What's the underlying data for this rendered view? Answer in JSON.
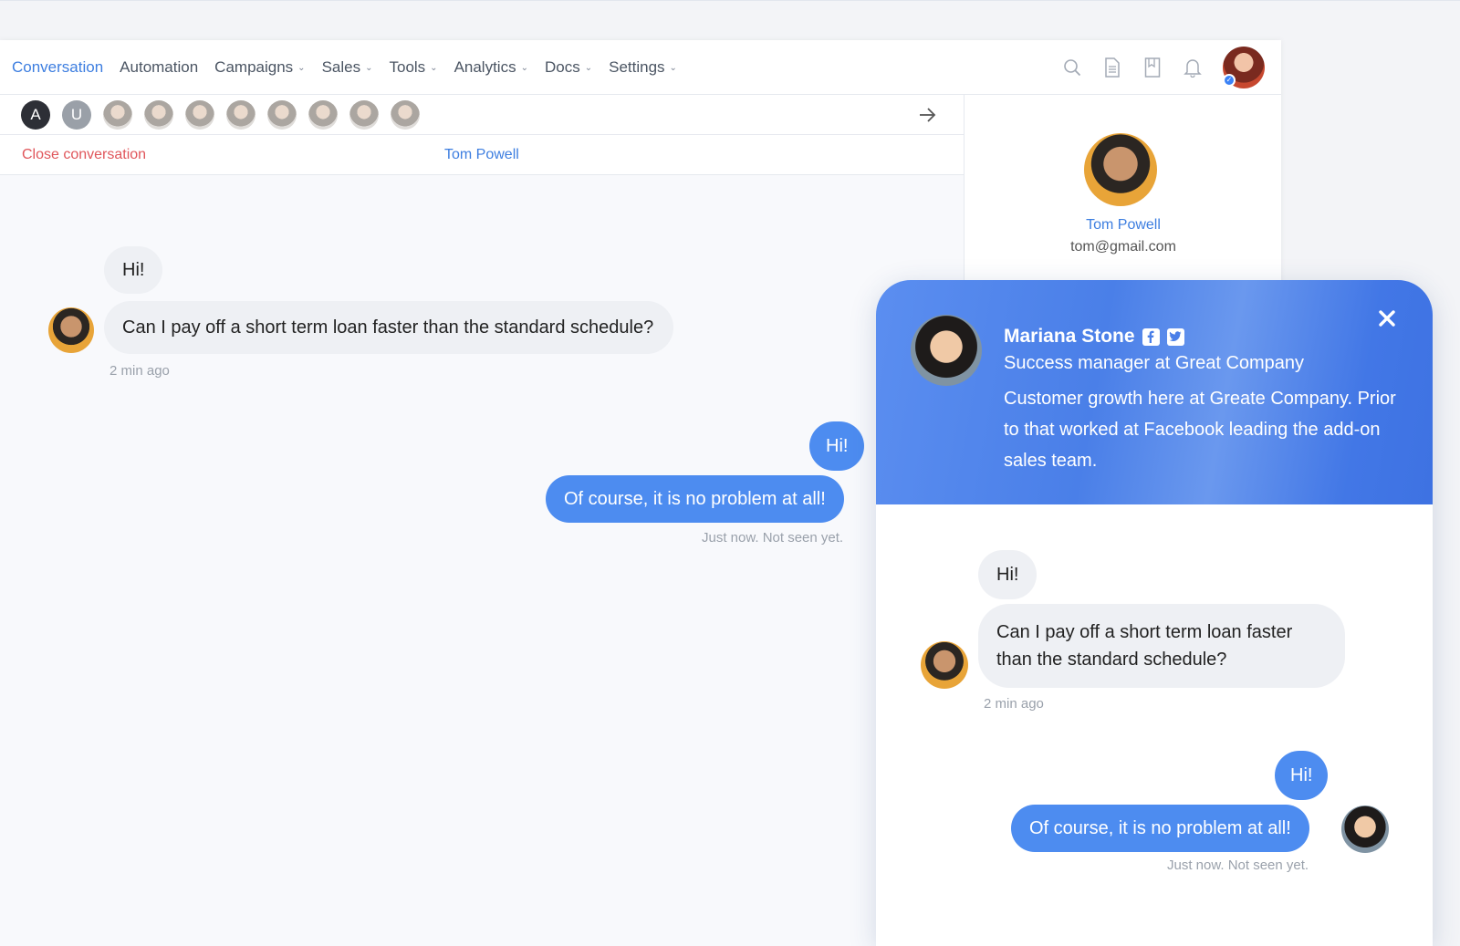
{
  "nav": {
    "items": [
      {
        "label": "Conversation",
        "active": true,
        "dropdown": false
      },
      {
        "label": "Automation",
        "active": false,
        "dropdown": false
      },
      {
        "label": "Campaigns",
        "active": false,
        "dropdown": true
      },
      {
        "label": "Sales",
        "active": false,
        "dropdown": true
      },
      {
        "label": "Tools",
        "active": false,
        "dropdown": true
      },
      {
        "label": "Analytics",
        "active": false,
        "dropdown": true
      },
      {
        "label": "Docs",
        "active": false,
        "dropdown": true
      },
      {
        "label": "Settings",
        "active": false,
        "dropdown": true
      }
    ],
    "icons": [
      "search-icon",
      "document-icon",
      "bookmark-icon",
      "bell-icon"
    ],
    "chevron": "⌄"
  },
  "avatar_strip": {
    "letters": [
      "A",
      "U"
    ],
    "photo_count": 8
  },
  "conversation": {
    "close_label": "Close conversation",
    "contact_name": "Tom Powell"
  },
  "profile": {
    "name": "Tom Powell",
    "email": "tom@gmail.com"
  },
  "chat": {
    "incoming_greeting": "Hi!",
    "incoming_question": "Can I pay off a short term loan faster than the standard schedule?",
    "incoming_time": "2 min ago",
    "outgoing_greeting": "Hi!",
    "outgoing_answer": "Of course, it is no problem at all!",
    "outgoing_status": "Just now. Not seen yet."
  },
  "widget": {
    "agent_name": "Mariana Stone",
    "agent_title": "Success manager at Great Company",
    "agent_bio": "Customer growth here at Greate Company. Prior to that worked at Facebook leading the add-on sales team.",
    "social": [
      "facebook-icon",
      "twitter-icon"
    ],
    "messages": {
      "incoming_greeting": "Hi!",
      "incoming_question": "Can I pay off a short term loan faster than the standard schedule?",
      "incoming_time": "2 min ago",
      "outgoing_greeting": "Hi!",
      "outgoing_answer": "Of course, it is no problem at all!",
      "outgoing_status": "Just now. Not seen yet."
    }
  },
  "colors": {
    "accent": "#3d7ee0",
    "danger": "#e0565b",
    "bubble_out": "#4d8cf0",
    "bubble_in": "#eef0f4"
  }
}
